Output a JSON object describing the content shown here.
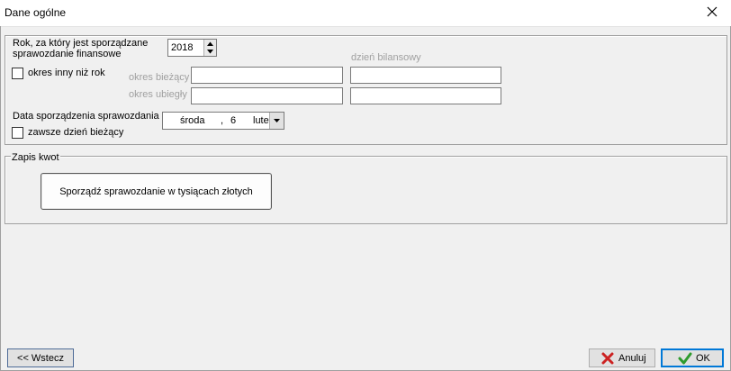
{
  "window": {
    "title": "Dane ogólne"
  },
  "general": {
    "year_label_line1": "Rok, za który jest sporządzane",
    "year_label_line2": "sprawozdanie finansowe",
    "year_value": "2018",
    "other_period_label": "okres inny niż rok",
    "balance_day_label": "dzień bilansowy",
    "current_period_label": "okres bieżący",
    "previous_period_label": "okres ubiegły",
    "current_period_from": "",
    "current_period_to": "",
    "previous_period_from": "",
    "previous_period_to": "",
    "prep_date_label": "Data sporządzenia sprawozdania",
    "always_today_label": "zawsze dzień bieżący",
    "date_weekday": "środa",
    "date_sep": ",",
    "date_day": "6",
    "date_month": "lute"
  },
  "amounts": {
    "legend": "Zapis kwot",
    "thousands_button": "Sporządź sprawozdanie w tysiącach złotych"
  },
  "footer": {
    "back_label": "<< Wstecz",
    "cancel_label": "Anuluj",
    "ok_label": "OK"
  },
  "colors": {
    "cancel_x": "#cc2222",
    "ok_check": "#2e9b2e",
    "focus_border": "#0078d7"
  }
}
